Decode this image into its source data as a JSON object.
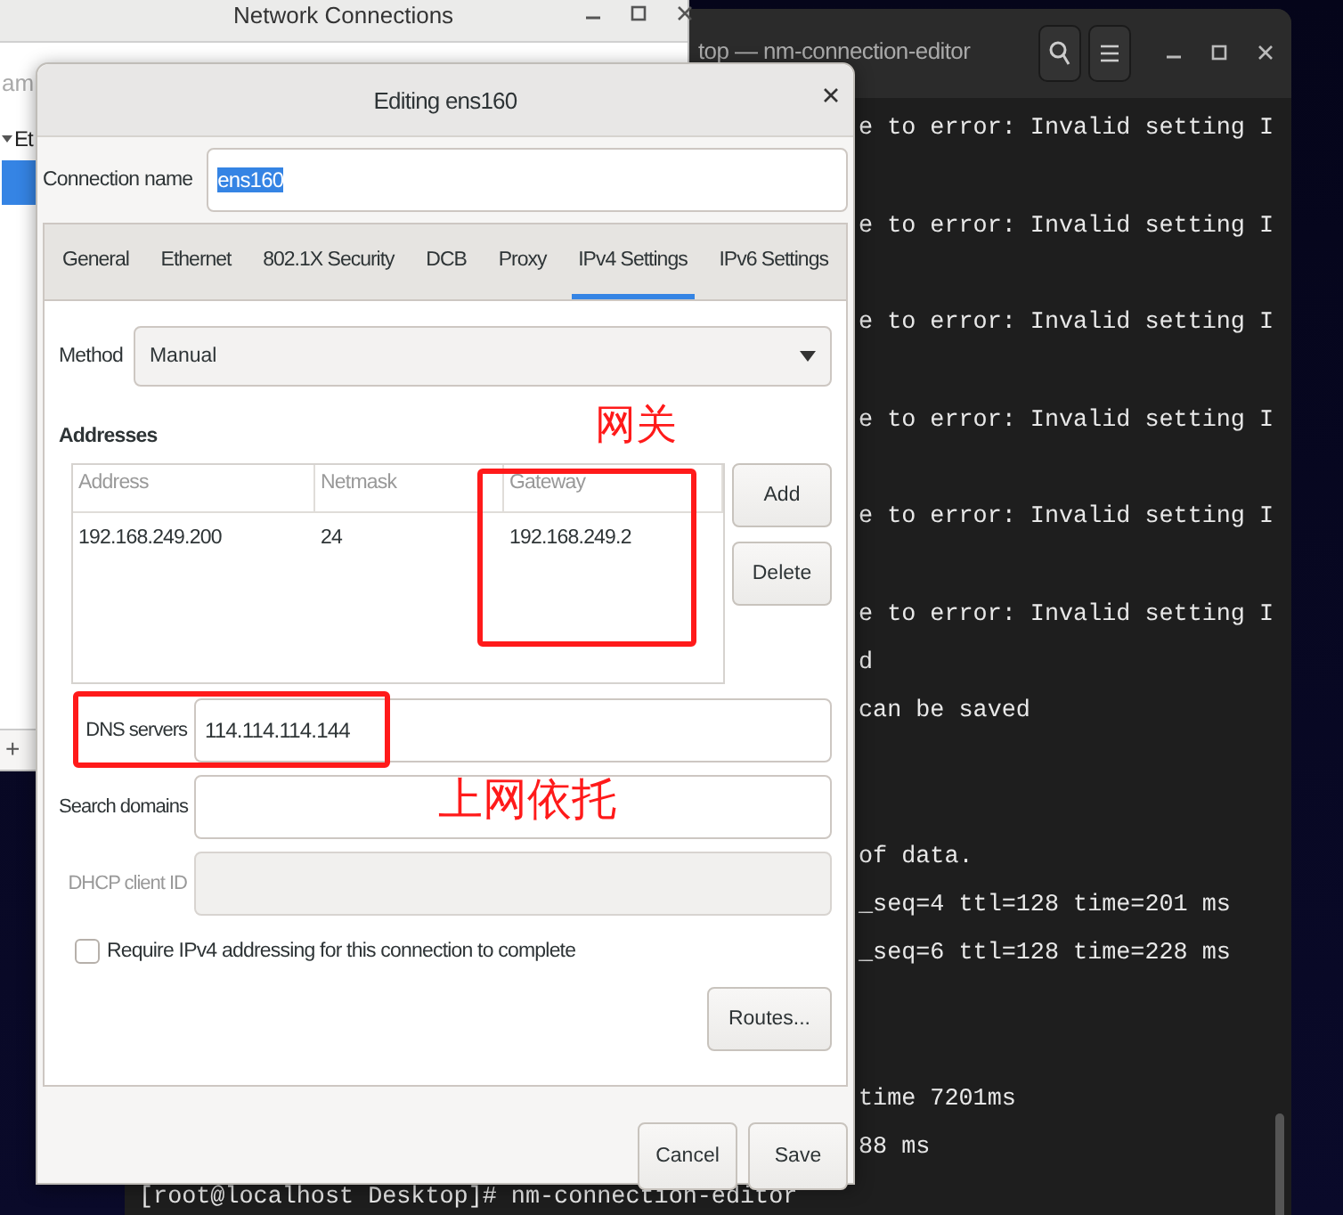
{
  "terminal": {
    "title": "top — nm-connection-editor",
    "lines": [
      {
        "kind": "tail",
        "text": "e to error: Invalid setting I"
      },
      {
        "kind": "blank"
      },
      {
        "kind": "tail",
        "text": "e to error: Invalid setting I"
      },
      {
        "kind": "blank"
      },
      {
        "kind": "tail",
        "text": "e to error: Invalid setting I"
      },
      {
        "kind": "blank"
      },
      {
        "kind": "tail",
        "text": "e to error: Invalid setting I"
      },
      {
        "kind": "blank"
      },
      {
        "kind": "tail",
        "text": "e to error: Invalid setting I"
      },
      {
        "kind": "blank"
      },
      {
        "kind": "tail",
        "text": "e to error: Invalid setting I"
      },
      {
        "kind": "tail",
        "text": "d"
      },
      {
        "kind": "tail",
        "text": "can be saved"
      },
      {
        "kind": "blank"
      },
      {
        "kind": "blank"
      },
      {
        "kind": "tail",
        "text": "of data."
      },
      {
        "kind": "tail",
        "text": "_seq=4 ttl=128 time=201 ms"
      },
      {
        "kind": "tail",
        "text": "_seq=6 ttl=128 time=228 ms"
      },
      {
        "kind": "blank"
      },
      {
        "kind": "blank"
      },
      {
        "kind": "tail",
        "text": "time 7201ms"
      },
      {
        "kind": "tail",
        "text": "88 ms"
      },
      {
        "kind": "full",
        "text": "[root@localhost Desktop]# nm-connection-editor"
      }
    ]
  },
  "background_window": {
    "title": "Network Connections",
    "column_header": "am",
    "rows": [
      {
        "label": "Et",
        "selected": false
      },
      {
        "selected": true
      }
    ],
    "add_label": "+"
  },
  "dialog": {
    "title": "Editing ens160",
    "connection_name": {
      "label": "Connection name",
      "value": "ens160",
      "text_selected": true
    },
    "tabs": [
      {
        "label": "General",
        "selected": false
      },
      {
        "label": "Ethernet",
        "selected": false
      },
      {
        "label": "802.1X Security",
        "selected": false
      },
      {
        "label": "DCB",
        "selected": false
      },
      {
        "label": "Proxy",
        "selected": false
      },
      {
        "label": "IPv4 Settings",
        "selected": true
      },
      {
        "label": "IPv6 Settings",
        "selected": false
      }
    ],
    "method": {
      "label": "Method",
      "value": "Manual"
    },
    "addresses": {
      "title": "Addresses",
      "columns": [
        "Address",
        "Netmask",
        "Gateway"
      ],
      "rows": [
        [
          "192.168.249.200",
          "24",
          "192.168.249.2"
        ]
      ],
      "buttons": [
        "Add",
        "Delete"
      ]
    },
    "fields": [
      {
        "label": "DNS servers",
        "value": "114.114.114.144",
        "disabled": false
      },
      {
        "label": "Search domains",
        "disabled": false
      },
      {
        "label": "DHCP client ID",
        "disabled": true
      }
    ],
    "require_checkbox": {
      "label": "Require IPv4 addressing for this connection to complete",
      "checked": false
    },
    "routes_button": "Routes...",
    "buttons": [
      "Cancel",
      "Save"
    ]
  },
  "annotations": [
    {
      "kind": "box"
    },
    {
      "kind": "label",
      "text": "网关"
    },
    {
      "kind": "box"
    },
    {
      "kind": "label",
      "text": "上网依托"
    }
  ]
}
